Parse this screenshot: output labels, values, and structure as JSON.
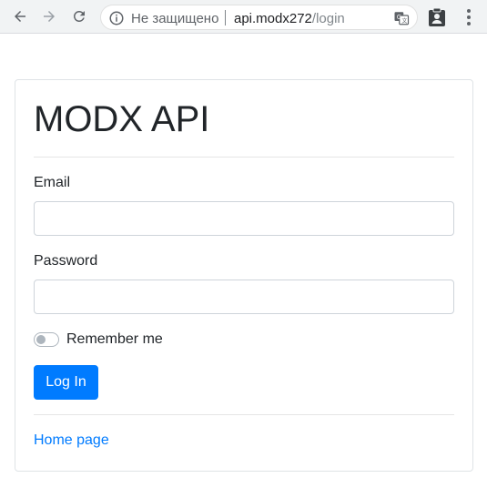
{
  "browser": {
    "security_label": "Не защищено",
    "url_host": "api.modx272",
    "url_path": "/login",
    "icons": {
      "back": "arrow-left-icon",
      "forward": "arrow-right-icon",
      "reload": "reload-icon",
      "info": "info-icon",
      "translate": "translate-icon",
      "extension": "clipboard-account-icon",
      "menu": "kebab-menu-icon"
    }
  },
  "login_card": {
    "title": "MODX API",
    "email_label": "Email",
    "email_value": "",
    "password_label": "Password",
    "password_value": "",
    "remember_label": "Remember me",
    "remember_checked": false,
    "login_button": "Log In",
    "home_link": "Home page"
  },
  "colors": {
    "primary": "#007bff",
    "text": "#212529",
    "border": "#ced4da"
  }
}
